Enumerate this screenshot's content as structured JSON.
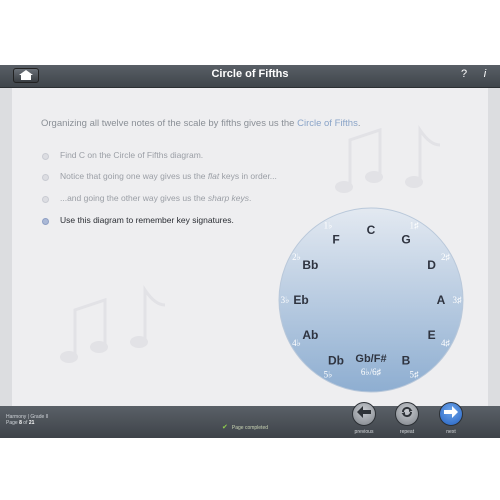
{
  "header": {
    "title": "Circle of Fifths",
    "help_label": "?",
    "info_label": "i",
    "home_icon": "home-icon"
  },
  "content": {
    "intro_text": "Organizing all twelve notes of the scale by fifths gives us the ",
    "intro_link": "Circle of Fifths",
    "intro_end": ".",
    "bullets": [
      {
        "pre": "Find C on the Circle of Fifths diagram.",
        "em": "",
        "post": "",
        "active": false
      },
      {
        "pre": "Notice that going one way gives us the ",
        "em": "flat",
        "post": " keys in order...",
        "active": false
      },
      {
        "pre": "...and going the other way gives us the ",
        "em": "sharp keys",
        "post": ".",
        "active": false
      },
      {
        "pre": "Use this diagram to remember key signatures.",
        "em": "",
        "post": "",
        "active": true
      }
    ]
  },
  "circle": {
    "keys": [
      {
        "name": "C",
        "sig": ""
      },
      {
        "name": "G",
        "sig": "1♯"
      },
      {
        "name": "D",
        "sig": "2♯"
      },
      {
        "name": "A",
        "sig": "3♯"
      },
      {
        "name": "E",
        "sig": "4♯"
      },
      {
        "name": "B",
        "sig": "5♯"
      },
      {
        "name": "Gb/F#",
        "sig": "6♭/6♯"
      },
      {
        "name": "Db",
        "sig": "5♭"
      },
      {
        "name": "Ab",
        "sig": "4♭"
      },
      {
        "name": "Eb",
        "sig": "3♭"
      },
      {
        "name": "Bb",
        "sig": "2♭"
      },
      {
        "name": "F",
        "sig": "1♭"
      }
    ]
  },
  "footer": {
    "course_line1": "Harmony | Grade II",
    "page_prefix": "Page ",
    "page_current": "8",
    "page_mid": " of ",
    "page_total": "21",
    "status_text": "Page completed",
    "previous_label": "previous",
    "repeat_label": "repeat",
    "next_label": "next"
  },
  "colors": {
    "accent_blue": "#2f6fd1",
    "link": "#8aa4c8",
    "circle_top": "#dfe6ef",
    "circle_bottom": "#8fb0d2"
  }
}
